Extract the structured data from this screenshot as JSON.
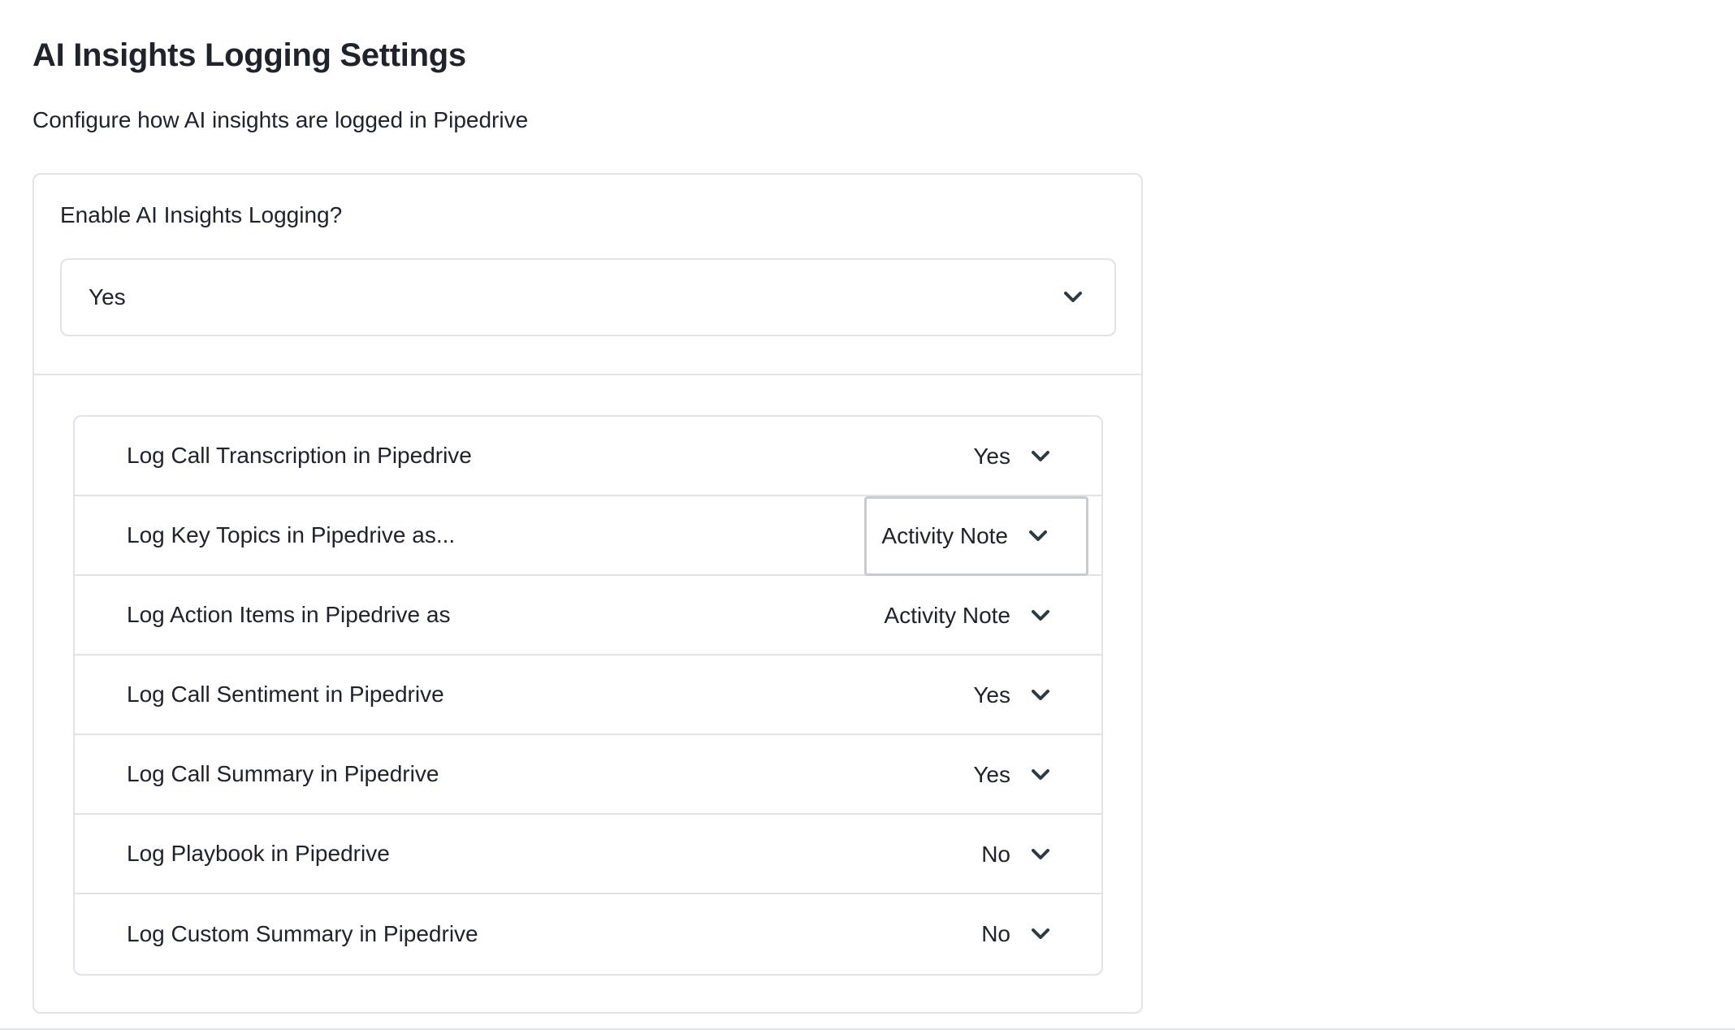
{
  "page": {
    "title": "AI Insights Logging Settings",
    "subtitle": "Configure how AI insights are logged in Pipedrive"
  },
  "enable": {
    "label": "Enable AI Insights Logging?",
    "value": "Yes"
  },
  "options": [
    {
      "label": "Log Call Transcription in Pipedrive",
      "value": "Yes"
    },
    {
      "label": "Log Key Topics in Pipedrive as...",
      "value": "Activity Note"
    },
    {
      "label": "Log Action Items in Pipedrive as",
      "value": "Activity Note"
    },
    {
      "label": "Log Call Sentiment in Pipedrive",
      "value": "Yes"
    },
    {
      "label": "Log Call Summary in Pipedrive",
      "value": "Yes"
    },
    {
      "label": "Log Playbook in Pipedrive",
      "value": "No"
    },
    {
      "label": "Log Custom Summary in Pipedrive",
      "value": "No"
    }
  ],
  "icons": {
    "dropdown": "chevron-down-icon"
  },
  "colors": {
    "text": "#21232c",
    "border": "#e2e3e6",
    "focus_border": "#c9cbd0"
  }
}
